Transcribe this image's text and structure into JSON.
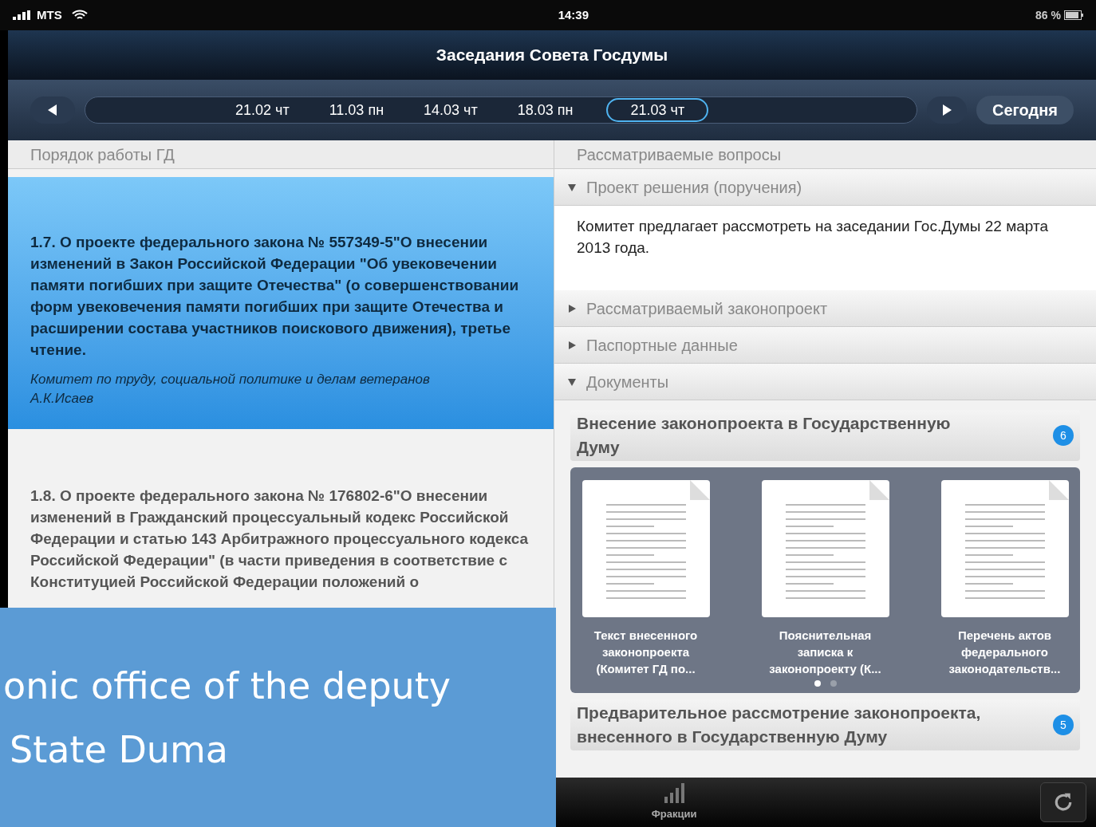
{
  "status_bar": {
    "carrier": "MTS",
    "time": "14:39",
    "battery": "86 %"
  },
  "title": "Заседания Совета Госдумы",
  "dates": [
    {
      "label": "21.02 чт",
      "selected": false
    },
    {
      "label": "11.03 пн",
      "selected": false
    },
    {
      "label": "14.03 чт",
      "selected": false
    },
    {
      "label": "18.03 пн",
      "selected": false
    },
    {
      "label": "21.03 чт",
      "selected": true
    }
  ],
  "today_button": "Сегодня",
  "left_panel": {
    "header": "Порядок работы ГД",
    "items": [
      {
        "number": "1.7.",
        "title": "О проекте федерального закона № 557349-5\"О внесении изменений в Закон Российской Федерации \"Об увековечении памяти погибших при защите Отечества\" (о совершенствовании форм увековечения памяти погибших при защите Отечества и расширении состава участников поискового движения), третье чтение.",
        "committee": "Комитет по труду, социальной политике  и делам ветеранов А.К.Исаев",
        "selected": true
      },
      {
        "number": "1.8.",
        "title": "О проекте федерального закона № 176802-6\"О внесении изменений в Гражданский процессуальный кодекс Российской Федерации и статью 143 Арбитражного процессуального кодекса Российской Федерации\" (в части приведения в соответствие с Конституцией Российской Федерации положений о",
        "selected": false
      }
    ]
  },
  "right_panel": {
    "header": "Рассматриваемые вопросы",
    "sections": [
      {
        "title": "Проект решения (поручения)",
        "expanded": true,
        "kind": "text",
        "text": "Комитет предлагает рассмотреть на заседании Гос.Думы 22 марта 2013 года."
      },
      {
        "title": "Рассматриваемый законопроект",
        "expanded": false
      },
      {
        "title": "Паспортные данные",
        "expanded": false
      },
      {
        "title": "Документы",
        "expanded": true,
        "kind": "documents",
        "groups": [
          {
            "title": "Внесение законопроекта в Государственную Думу",
            "count": "6",
            "documents": [
              "Текст внесенного законопроекта (Комитет ГД по...",
              "Пояснительная записка к законопроекту (К...",
              "Перечень актов федерального законодательств..."
            ],
            "pages": [
              {
                "selected": true
              },
              {
                "selected": false
              }
            ]
          },
          {
            "title": "Предварительное рассмотрение законопроекта, внесенного в Государственную Думу",
            "count": "5"
          }
        ]
      }
    ]
  },
  "tab_bar": [
    {
      "label": "Фракции",
      "kind": "chart",
      "selected": false
    }
  ],
  "overlay_caption": [
    "onic office of the deputy",
    "State Duma"
  ]
}
